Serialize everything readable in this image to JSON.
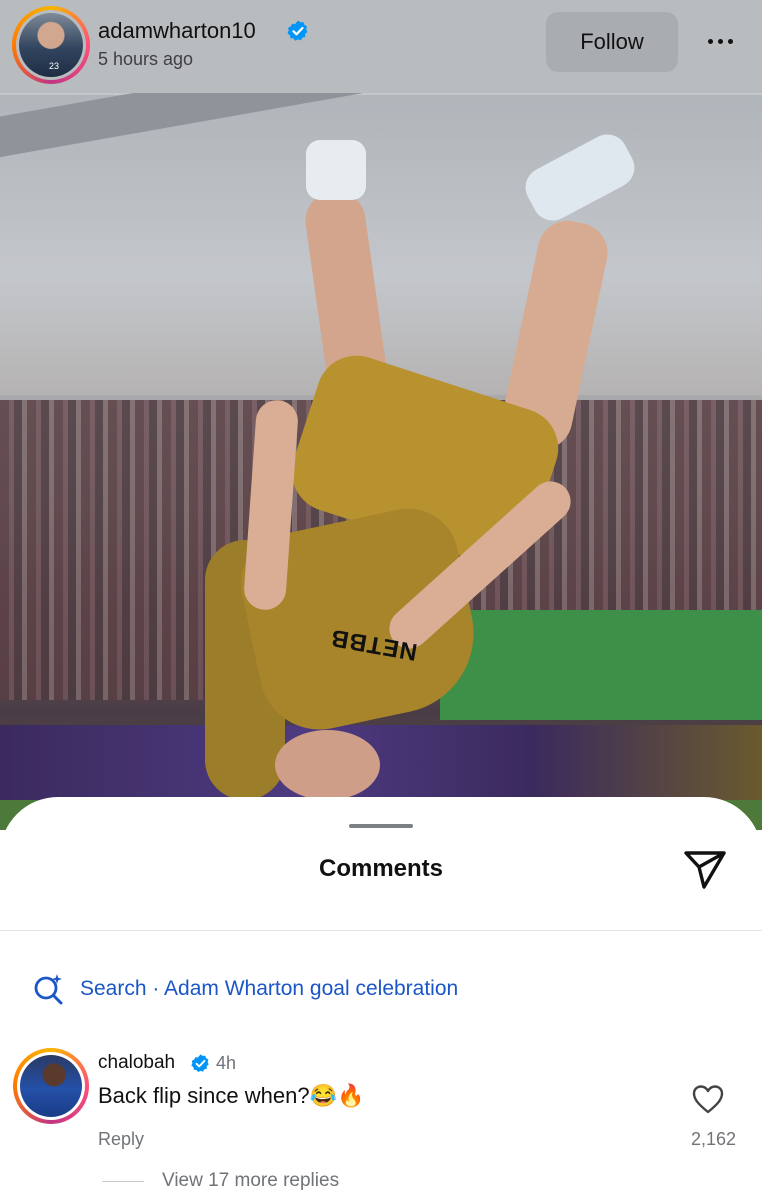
{
  "post": {
    "username": "adamwharton10",
    "time": "5 hours ago",
    "follow_label": "Follow",
    "avatar_number": "23"
  },
  "photo": {
    "jersey_sponsor": "NETBB"
  },
  "comments_sheet": {
    "title": "Comments",
    "search_text": "Search · Adam Wharton goal celebration",
    "comment": {
      "username": "chalobah",
      "time": "4h",
      "text": "Back flip since when?😂🔥",
      "reply_label": "Reply",
      "likes": "2,162",
      "more_replies": "View 17 more replies"
    }
  },
  "icons": {
    "verified": "verified-badge-icon",
    "more": "more-options-icon",
    "share": "send-icon",
    "search": "ai-search-icon",
    "like": "heart-icon"
  },
  "colors": {
    "verified_blue": "#0095f6",
    "search_link": "#1b56c7",
    "header_bg": "#b9bcbf"
  }
}
